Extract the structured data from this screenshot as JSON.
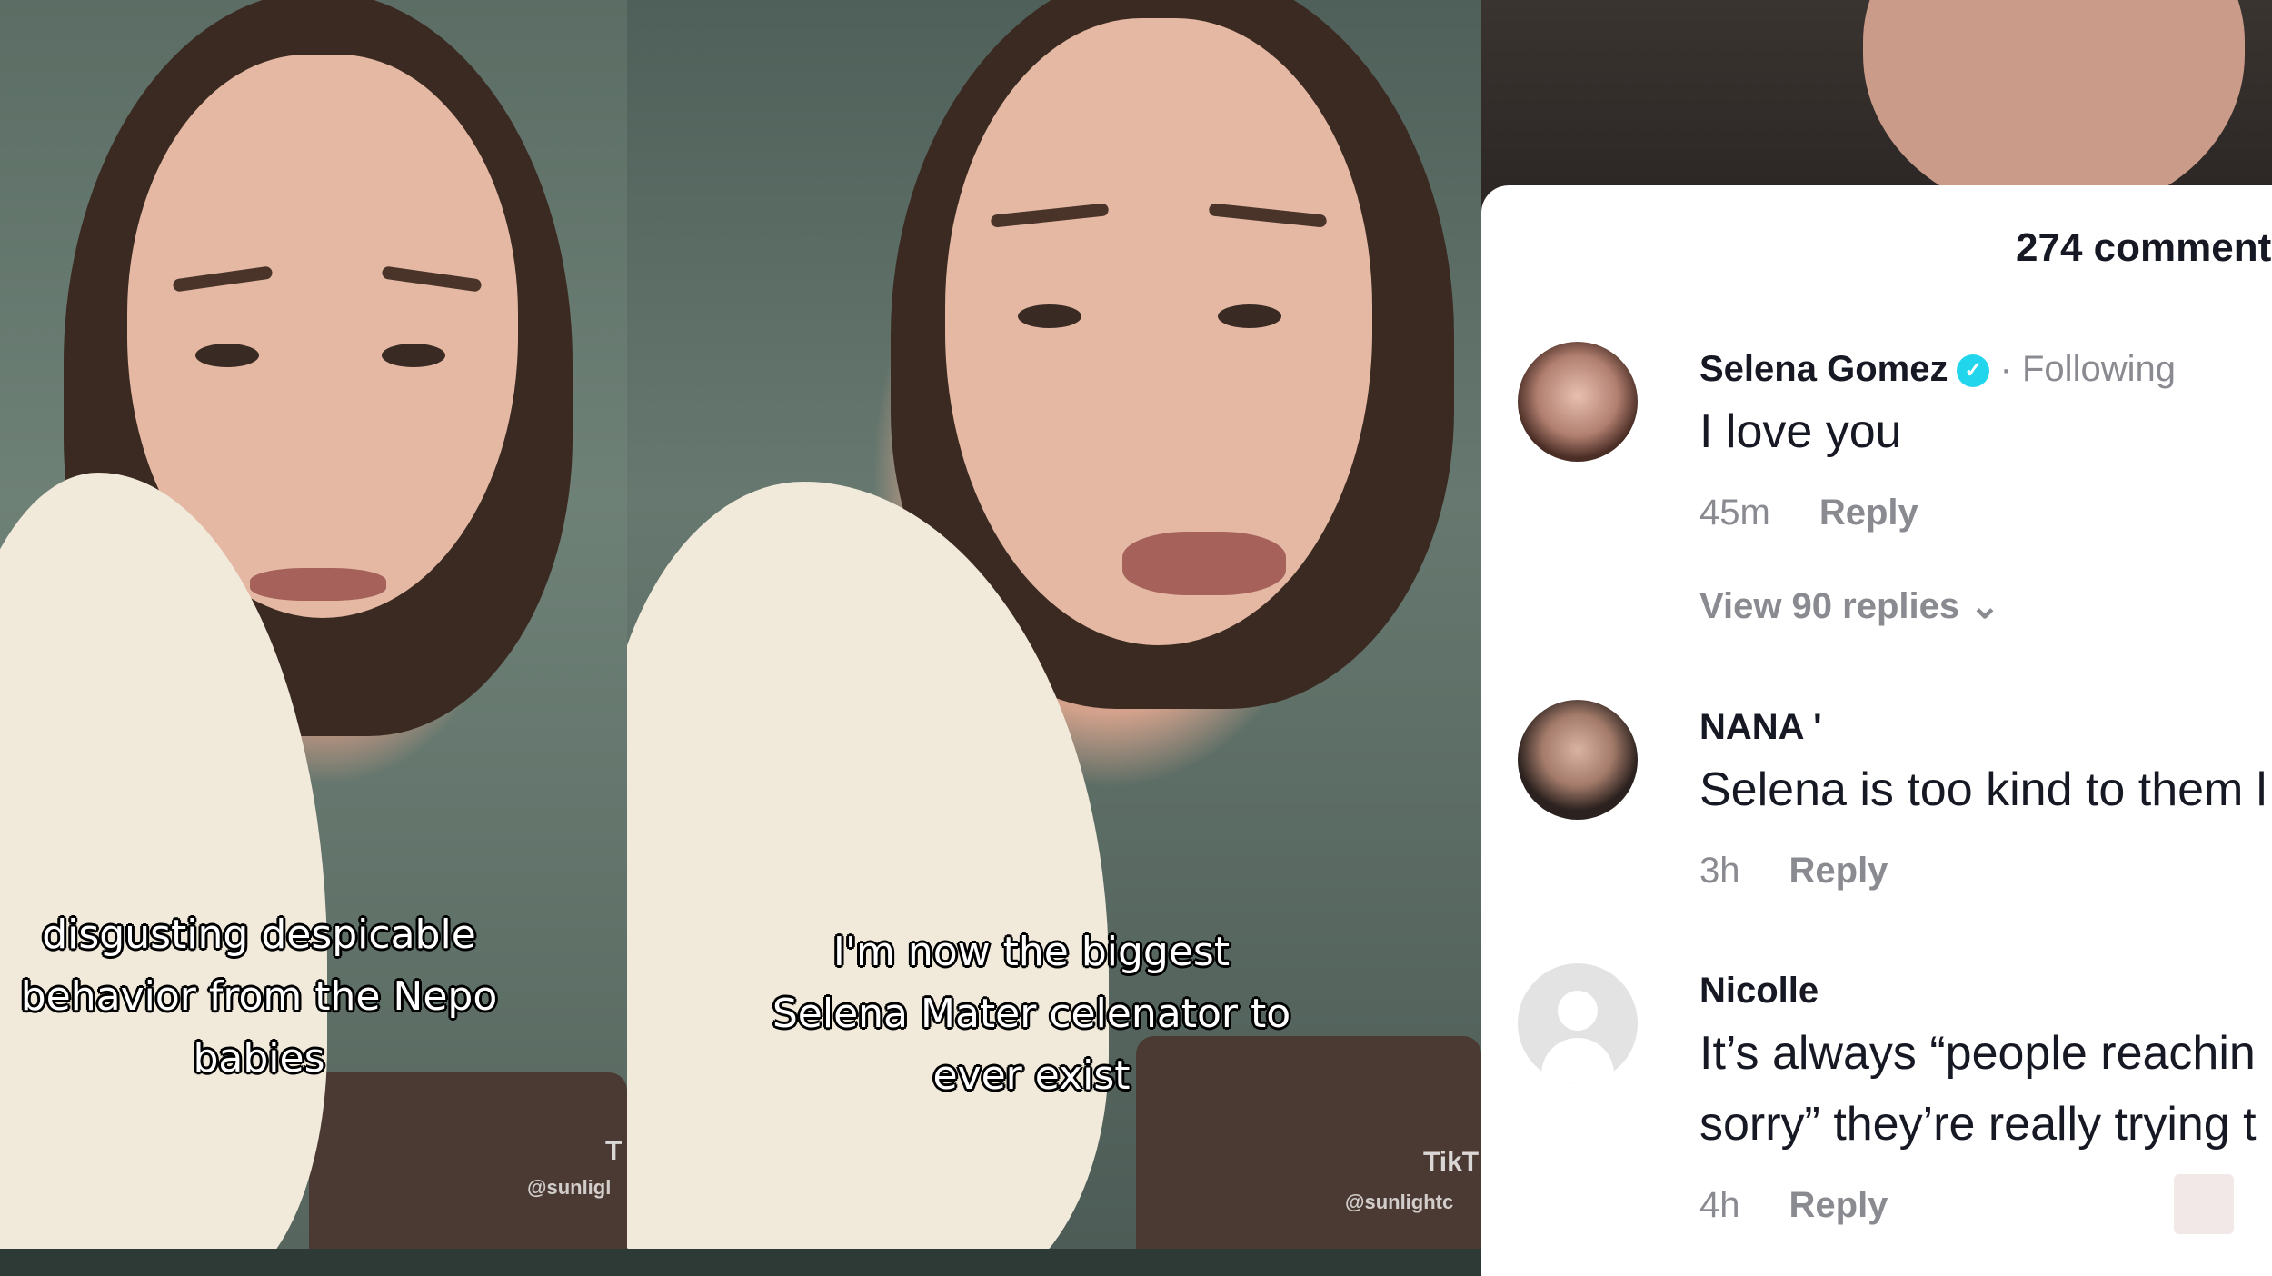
{
  "panel1": {
    "caption": "disgusting despicable\nbehavior from the Nepo\nbabies",
    "watermark": "@sunligl",
    "logo_letter": "T"
  },
  "panel2": {
    "caption": "I'm now the biggest\nSelena Mater celenator to\never exist",
    "watermark": "@sunlightc",
    "logo_text": "TikT"
  },
  "comments_panel": {
    "count": "274 comment",
    "comments": [
      {
        "username": "Selena Gomez",
        "verified": true,
        "following": "· Following",
        "text": "I love you",
        "time": "45m",
        "reply": "Reply",
        "view_replies": "View 90 replies"
      },
      {
        "username": "NANA '",
        "text": "Selena is too kind to them l",
        "time": "3h",
        "reply": "Reply"
      },
      {
        "username": "Nicolle",
        "text_line1": "It’s always “people reachin",
        "text_line2": "sorry” they’re really trying t",
        "time": "4h",
        "reply": "Reply"
      }
    ]
  },
  "colors": {
    "verified": "#20d5ec",
    "muted": "#8a8b91",
    "text": "#161823"
  }
}
